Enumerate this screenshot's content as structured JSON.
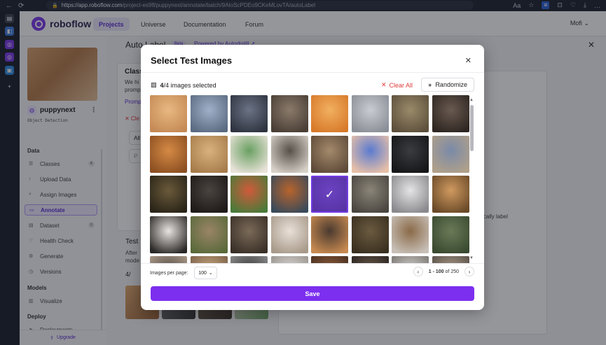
{
  "browser": {
    "url_host": "https://app.roboflow.com",
    "url_path": "/project-es9fl/puppynext/annotate/batch/9AIoScPDEo9CKeMLovTA/autoLabel",
    "nav": [
      "←",
      "⟳"
    ],
    "right_icons": [
      "Aa",
      "☆",
      "⊡",
      "♡",
      "⤓",
      "…"
    ]
  },
  "vertical_tabs": [
    {
      "glyph": "▤",
      "color": "#3b4352"
    },
    {
      "glyph": "◧",
      "color": "#3d7be0"
    },
    {
      "glyph": "◎",
      "color": "#7c3aed"
    },
    {
      "glyph": "◎",
      "color": "#7c3aed"
    },
    {
      "glyph": "▣",
      "color": "#2c8be0"
    },
    {
      "glyph": "+",
      "color": "transparent"
    }
  ],
  "topnav": {
    "brand": "roboflow",
    "items": [
      "Projects",
      "Universe",
      "Documentation",
      "Forum"
    ],
    "active": "Projects",
    "user": "Mofi"
  },
  "sidebar": {
    "project_name": "puppynext",
    "project_type": "Object Detection",
    "sections": {
      "data": "Data",
      "models": "Models",
      "deploy": "Deploy"
    },
    "data_items": [
      {
        "label": "Classes",
        "icon": "list-icon",
        "count": "4"
      },
      {
        "label": "Upload Data",
        "icon": "upload-icon",
        "count": ""
      },
      {
        "label": "Assign Images",
        "icon": "search-icon",
        "count": ""
      },
      {
        "label": "Annotate",
        "icon": "annotate-icon",
        "count": "",
        "active": true
      },
      {
        "label": "Dataset",
        "icon": "dataset-icon",
        "count": "0"
      },
      {
        "label": "Health Check",
        "icon": "health-icon",
        "count": ""
      },
      {
        "label": "Generate",
        "icon": "generate-icon",
        "count": ""
      },
      {
        "label": "Versions",
        "icon": "versions-icon",
        "count": ""
      }
    ],
    "model_items": [
      {
        "label": "Visualize",
        "icon": "chart-icon"
      }
    ],
    "deploy_items": [
      {
        "label": "Deployments",
        "icon": "deploy-icon"
      }
    ],
    "upgrade": "Upgrade"
  },
  "main": {
    "title": "Auto Label",
    "beta": "Beta",
    "powered": "Powered by Autodistill ↗",
    "bg_texts": [
      "Class",
      "We hi",
      "promp",
      "Promp",
      "✕ Cle",
      "All",
      "P",
      "Test",
      "After",
      "mode",
      "4/",
      "ically label"
    ]
  },
  "modal": {
    "title": "Select Test Images",
    "selected_count": "4",
    "selected_total": "/4 images selected",
    "clear_all": "Clear All",
    "randomize": "Randomize",
    "per_page_label": "Images per page:",
    "per_page_value": "100",
    "range": "1 - 100",
    "range_of": "of 250",
    "save": "Save"
  },
  "tiles": [
    {
      "colors": [
        "#e8b882",
        "#c58a55"
      ],
      "selected": false
    },
    {
      "colors": [
        "#9fb0c8",
        "#5b6b82"
      ],
      "selected": false
    },
    {
      "colors": [
        "#6b7385",
        "#2f3440"
      ],
      "selected": false
    },
    {
      "colors": [
        "#8a7a6a",
        "#4a3f36"
      ],
      "selected": false
    },
    {
      "colors": [
        "#f1b060",
        "#d77a2a"
      ],
      "selected": false
    },
    {
      "colors": [
        "#c9ccd2",
        "#8a8e96"
      ],
      "selected": false
    },
    {
      "colors": [
        "#9a8a6a",
        "#5d503c"
      ],
      "selected": false
    },
    {
      "colors": [
        "#6a5a50",
        "#2e2622"
      ],
      "selected": false
    },
    {
      "colors": [
        "#d58a45",
        "#8d5022"
      ],
      "selected": false
    },
    {
      "colors": [
        "#d8b27e",
        "#a77c4c"
      ],
      "selected": false
    },
    {
      "colors": [
        "#6aa062",
        "#e8e2d8"
      ],
      "selected": false
    },
    {
      "colors": [
        "#585048",
        "#d6d0c8"
      ],
      "selected": false
    },
    {
      "colors": [
        "#a48a6c",
        "#5e4a38"
      ],
      "selected": false
    },
    {
      "colors": [
        "#5a7bd0",
        "#e8c0a8"
      ],
      "selected": false
    },
    {
      "colors": [
        "#3a3c40",
        "#151618"
      ],
      "selected": false
    },
    {
      "colors": [
        "#7a8aa8",
        "#b0a08a"
      ],
      "selected": false
    },
    {
      "colors": [
        "#6a5a3a",
        "#2a2418"
      ],
      "selected": false
    },
    {
      "colors": [
        "#4a4440",
        "#1e1a18"
      ],
      "selected": false
    },
    {
      "colors": [
        "#d05a3a",
        "#4a7a3a"
      ],
      "selected": false
    },
    {
      "colors": [
        "#b8642c",
        "#3a4a5a"
      ],
      "selected": false
    },
    {
      "colors": [
        "#6a4aa0",
        "#3a2a60"
      ],
      "selected": true
    },
    {
      "colors": [
        "#8a8478",
        "#4a4640"
      ],
      "selected": false
    },
    {
      "colors": [
        "#e4e4e6",
        "#8a8a8e"
      ],
      "selected": false
    },
    {
      "colors": [
        "#d09a60",
        "#6a4a28"
      ],
      "selected": false
    },
    {
      "colors": [
        "#e8e4e0",
        "#2a2826"
      ],
      "selected": false
    },
    {
      "colors": [
        "#9a8468",
        "#5a6a3a"
      ],
      "selected": false
    },
    {
      "colors": [
        "#7a6a58",
        "#3a3028"
      ],
      "selected": false
    },
    {
      "colors": [
        "#e8e0d8",
        "#a89a8a"
      ],
      "selected": false
    },
    {
      "colors": [
        "#4a3a30",
        "#c88a50"
      ],
      "selected": false
    },
    {
      "colors": [
        "#6a5a40",
        "#3a3020"
      ],
      "selected": false
    },
    {
      "colors": [
        "#8a6a48",
        "#c8c0b8"
      ],
      "selected": false
    },
    {
      "colors": [
        "#6a7a58",
        "#3a4a30"
      ],
      "selected": false
    },
    {
      "colors": [
        "#5a5048",
        "#a89888"
      ],
      "selected": false
    },
    {
      "colors": [
        "#c8a880",
        "#7a6048"
      ],
      "selected": false
    },
    {
      "colors": [
        "#3a3a3a",
        "#8a8a8a"
      ],
      "selected": false
    },
    {
      "colors": [
        "#d8d4d0",
        "#9a948e"
      ],
      "selected": false
    },
    {
      "colors": [
        "#8a5a3a",
        "#4a3020"
      ],
      "selected": false
    },
    {
      "colors": [
        "#6a5a4a",
        "#2a2420"
      ],
      "selected": false
    },
    {
      "colors": [
        "#d0ccc8",
        "#7a7672"
      ],
      "selected": false
    },
    {
      "colors": [
        "#a89a88",
        "#5a5048"
      ],
      "selected": false
    }
  ]
}
